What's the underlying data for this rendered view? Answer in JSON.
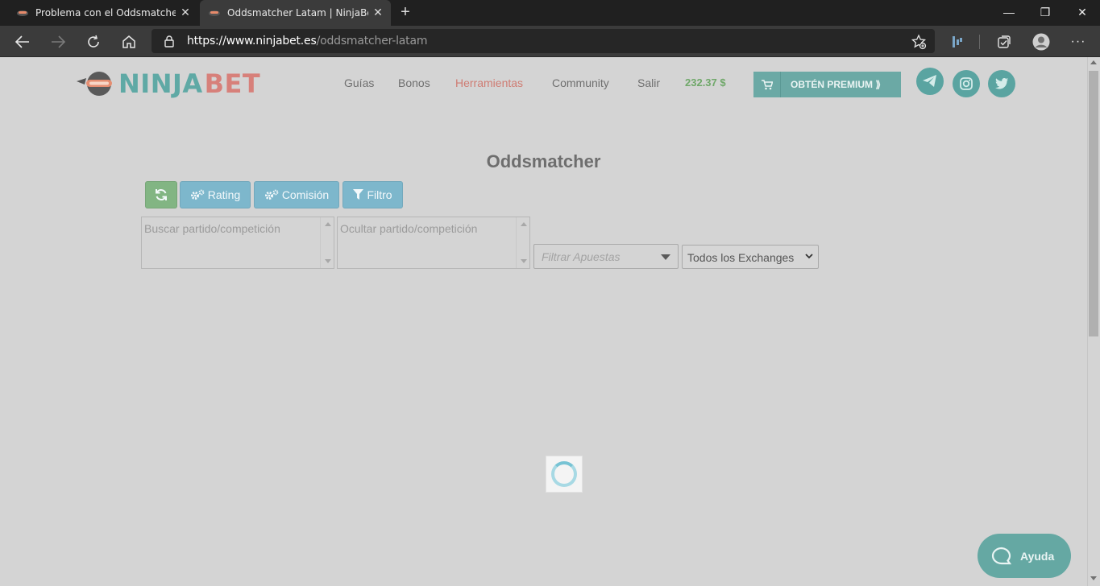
{
  "browser": {
    "tabs": [
      {
        "title": "Problema con el Oddsmatcher | N",
        "active": false
      },
      {
        "title": "Oddsmatcher Latam | NinjaBet.es",
        "active": true
      }
    ],
    "url": {
      "domain": "https://www.ninjabet.es",
      "path": "/oddsmatcher-latam"
    }
  },
  "site": {
    "logo": {
      "part1": "NINJA",
      "part2": "BET"
    },
    "nav": [
      "Guías",
      "Bonos",
      "Herramientas",
      "Community",
      "Salir"
    ],
    "active_nav": "Herramientas",
    "balance": "232.37 $",
    "premium_label": "OBTÉN PREMIUM ⟫"
  },
  "oddsmatcher": {
    "title": "Oddsmatcher",
    "buttons": {
      "rating": "Rating",
      "comision": "Comisión",
      "filtro": "Filtro"
    },
    "search_placeholder": "Buscar partido/competición",
    "hide_placeholder": "Ocultar partido/competición",
    "filter_bets_placeholder": "Filtrar Apuestas",
    "exchanges_selected": "Todos los Exchanges"
  },
  "help_label": "Ayuda",
  "colors": {
    "teal": "#5fa9a5",
    "salmon": "#d7807a",
    "green": "#82b583",
    "blue": "#7db7cc"
  }
}
